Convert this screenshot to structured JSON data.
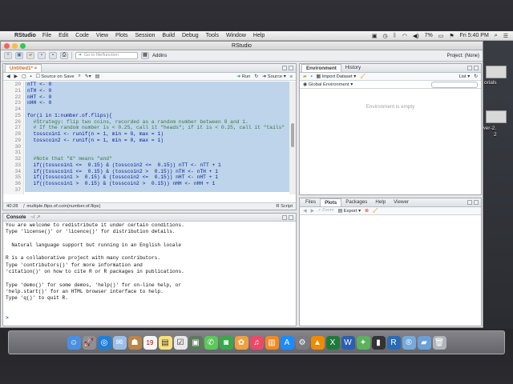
{
  "menubar": {
    "app_name": "RStudio",
    "items": [
      "File",
      "Edit",
      "Code",
      "View",
      "Plots",
      "Session",
      "Build",
      "Debug",
      "Tools",
      "Window",
      "Help"
    ],
    "battery": "7%",
    "clock": "Fri 5:40 PM"
  },
  "window": {
    "title": "RStudio"
  },
  "toolbar": {
    "goto_placeholder": "Go to file/function",
    "addins": "Addins",
    "project": "Project: (None)"
  },
  "editor": {
    "tab_label": "Untitled1*",
    "source_on_save": "Source on Save",
    "run": "Run",
    "source": "Source",
    "lines": [
      {
        "n": "20",
        "text": "nTT <- 0"
      },
      {
        "n": "21",
        "text": "nTH <- 0"
      },
      {
        "n": "22",
        "text": "nHT <- 0"
      },
      {
        "n": "23",
        "text": "nHH <- 0"
      },
      {
        "n": "24",
        "text": ""
      },
      {
        "n": "25",
        "text": "for(i in 1:number.of.flips){"
      },
      {
        "n": "26",
        "text": "  #Strategy: flip two coins, recorded as a random number between 0 and 1."
      },
      {
        "n": "27",
        "text": "  # If the random number is < 0.25, call it \"heads\"; if it is < 0.25, call it \"tails\""
      },
      {
        "n": "28",
        "text": "  tosscoin1 <- runif(n = 1, min = 0, max = 1)"
      },
      {
        "n": "29",
        "text": "  tosscoin2 <- runif(n = 1, min = 0, max = 1)"
      },
      {
        "n": "30",
        "text": ""
      },
      {
        "n": "31",
        "text": ""
      },
      {
        "n": "32",
        "text": "  #Note that \"&\" means \"and\""
      },
      {
        "n": "33",
        "text": "  if((tosscoin1 <=  0.15) & (tosscoin2 <=  0.15)) nTT <- nTT + 1"
      },
      {
        "n": "34",
        "text": "  if((tosscoin1 <=  0.15) & (tosscoin2 >  0.15)) nTH <- nTH + 1"
      },
      {
        "n": "35",
        "text": "  if((tosscoin1 >  0.15) & (tosscoin2 <=  0.15)) nHT <- nHT + 1"
      },
      {
        "n": "36",
        "text": "  if((tosscoin1 >  0.15) & (tosscoin2 >  0.15)) nHH <- nHH + 1"
      },
      {
        "n": "37",
        "text": ""
      }
    ],
    "status_pos": "40:28",
    "status_func": "multiple.flips.of.coin(number.of.flips)",
    "status_type": "R Script"
  },
  "console": {
    "label": "Console",
    "path": "~/",
    "lines": [
      "You are welcome to redistribute it under certain conditions.",
      "Type 'license()' or 'licence()' for distribution details.",
      "",
      "  Natural language support but running in an English locale",
      "",
      "R is a collaborative project with many contributors.",
      "Type 'contributors()' for more information and",
      "'citation()' on how to cite R or R packages in publications.",
      "",
      "Type 'demo()' for some demos, 'help()' for on-line help, or",
      "'help.start()' for an HTML browser interface to help.",
      "Type 'q()' to quit R.",
      "",
      ""
    ],
    "prompt": ">"
  },
  "env": {
    "tabs": [
      "Environment",
      "History"
    ],
    "import_dataset": "Import Dataset",
    "list_label": "List",
    "global_env": "Global Environment",
    "empty_text": "Environment is empty"
  },
  "files": {
    "tabs": [
      "Files",
      "Plots",
      "Packages",
      "Help",
      "Viewer"
    ],
    "zoom": "Zoom",
    "export": "Export"
  },
  "desktop": {
    "labels": [
      "orials",
      "wer-2.",
      "2"
    ]
  }
}
